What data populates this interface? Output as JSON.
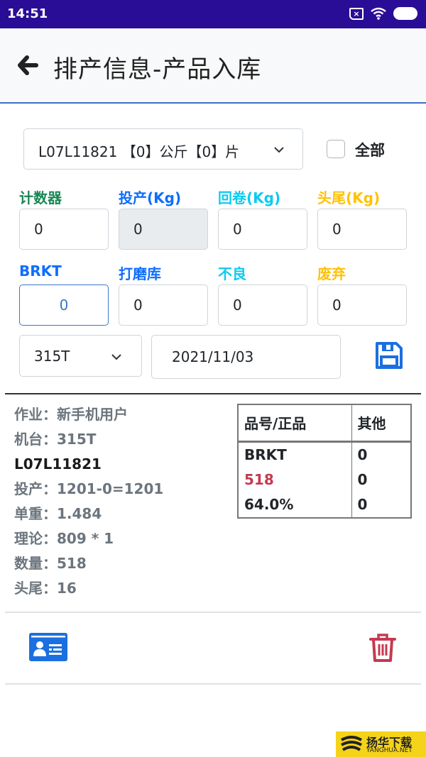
{
  "status_bar": {
    "time": "14:51",
    "icons": [
      "sim-off-icon",
      "wifi-icon",
      "battery-icon"
    ],
    "battery_level": "75"
  },
  "header": {
    "back_icon": "arrow-left-icon",
    "title": "排产信息-产品入库"
  },
  "form": {
    "lot_select": {
      "value": "L07L11821 【0】公斤【0】片"
    },
    "all_checkbox": {
      "label": "全部",
      "checked": false
    },
    "fields_row1": [
      {
        "label": "计数器",
        "value": "0",
        "color": "#198754",
        "state": "normal"
      },
      {
        "label": "投产(Kg)",
        "value": "0",
        "color": "#0d6efd",
        "state": "disabled"
      },
      {
        "label": "回卷(Kg)",
        "value": "0",
        "color": "#0dcaf0",
        "state": "normal"
      },
      {
        "label": "头尾(Kg)",
        "value": "0",
        "color": "#ffc107",
        "state": "normal"
      }
    ],
    "fields_row2": [
      {
        "label": "BRKT",
        "value": "0",
        "color": "#0d6efd",
        "state": "focused"
      },
      {
        "label": "打磨库",
        "value": "0",
        "color": "#0d6efd",
        "state": "normal"
      },
      {
        "label": "不良",
        "value": "0",
        "color": "#0dcaf0",
        "state": "normal"
      },
      {
        "label": "废弃",
        "value": "0",
        "color": "#ffc107",
        "state": "normal"
      }
    ],
    "machine_select": {
      "value": "315T"
    },
    "date": {
      "value": "2021/11/03"
    },
    "save_icon": "floppy-disk-icon"
  },
  "info": {
    "rows": [
      {
        "text": "作业：新手机用户"
      },
      {
        "text": "机台：315T"
      },
      {
        "text": "L07L11821",
        "strong": true
      },
      {
        "text": "投产：1201-0=1201"
      },
      {
        "text": "单重：1.484"
      },
      {
        "text": "理论：809 * 1"
      },
      {
        "text": "数量：518"
      },
      {
        "text": "头尾：16"
      }
    ]
  },
  "summary_table": {
    "headers": [
      "品号/正品",
      "其他"
    ],
    "col1": [
      "BRKT",
      "518",
      "64.0%"
    ],
    "col2": [
      "0",
      "0",
      "0"
    ],
    "highlight_color": "#c43a50"
  },
  "actions": {
    "card_icon": "id-card-icon",
    "delete_icon": "trash-icon"
  },
  "watermark": {
    "line1": "扬华下载",
    "line2": "YANGHUA.NET"
  }
}
